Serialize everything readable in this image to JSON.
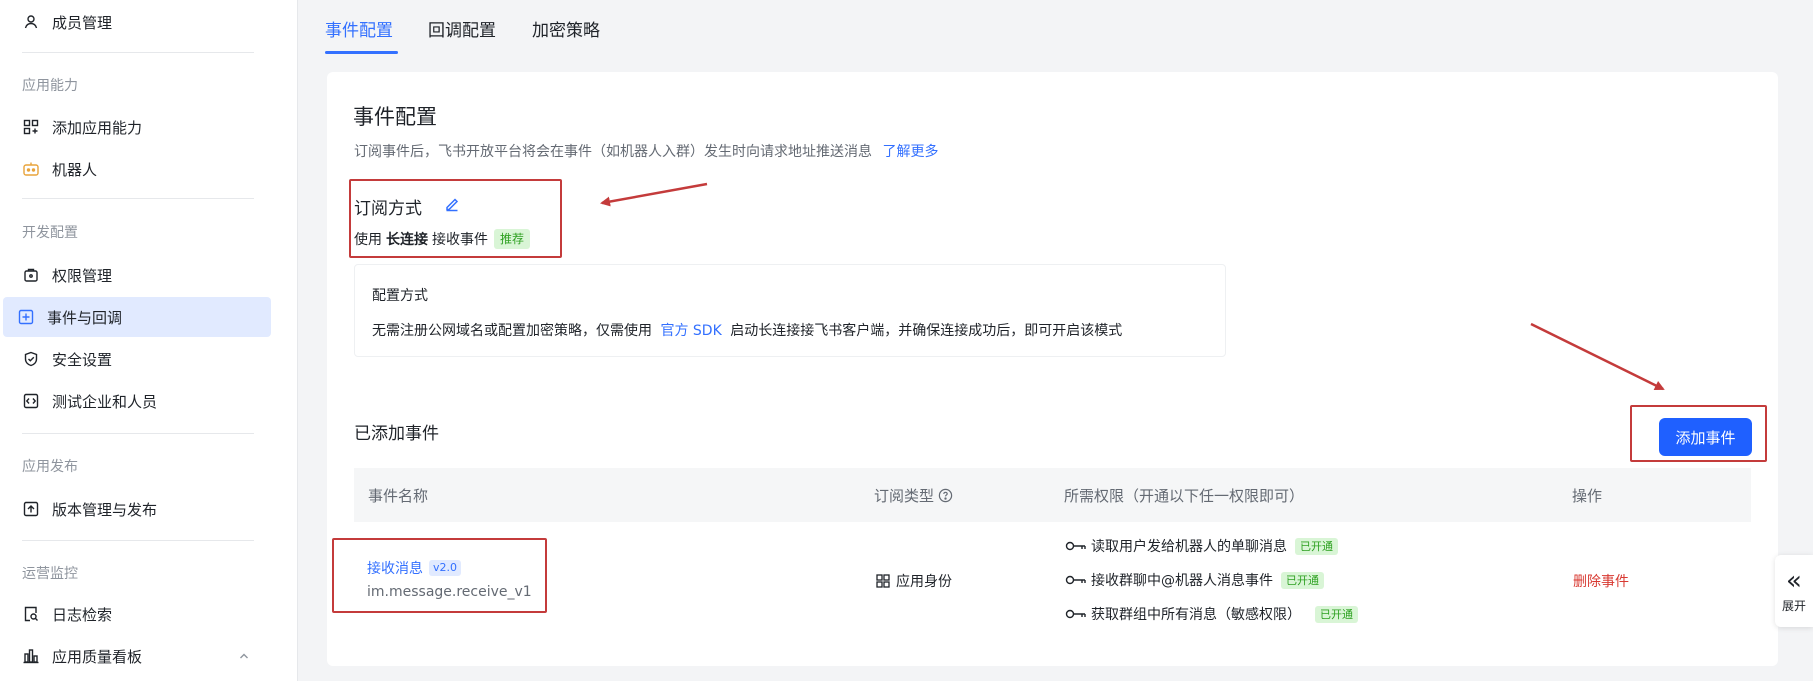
{
  "sidebar": {
    "member_mgmt": "成员管理",
    "section_app_capability": "应用能力",
    "add_capability": "添加应用能力",
    "bot": "机器人",
    "section_dev_config": "开发配置",
    "permission_mgmt": "权限管理",
    "events_callbacks": "事件与回调",
    "security_settings": "安全设置",
    "test_enterprise": "测试企业和人员",
    "section_app_release": "应用发布",
    "version_release": "版本管理与发布",
    "section_ops_monitor": "运营监控",
    "log_search": "日志检索",
    "quality_dashboard": "应用质量看板"
  },
  "tabs": [
    {
      "label": "事件配置"
    },
    {
      "label": "回调配置"
    },
    {
      "label": "加密策略"
    }
  ],
  "main": {
    "title": "事件配置",
    "description": "订阅事件后，飞书开放平台将会在事件（如机器人入群）发生时向请求地址推送消息",
    "learn_more": "了解更多",
    "subscription": {
      "title": "订阅方式",
      "prefix": "使用",
      "method": "长连接",
      "suffix": "接收事件",
      "recommend_tag": "推荐"
    },
    "config": {
      "title": "配置方式",
      "text_before": "无需注册公网域名或配置加密策略，仅需使用",
      "sdk_link": "官方 SDK",
      "text_after": "启动长连接接飞书客户端，并确保连接成功后，即可开启该模式"
    },
    "added_events": {
      "title": "已添加事件",
      "add_button": "添加事件",
      "headers": {
        "name": "事件名称",
        "type": "订阅类型",
        "perms": "所需权限（开通以下任一权限即可）",
        "ops": "操作"
      },
      "rows": [
        {
          "name": "接收消息",
          "version": "v2.0",
          "event_key": "im.message.receive_v1",
          "type": "应用身份",
          "permissions": [
            {
              "label": "读取用户发给机器人的单聊消息",
              "status": "已开通"
            },
            {
              "label": "接收群聊中@机器人消息事件",
              "status": "已开通"
            },
            {
              "label": "获取群组中所有消息（敏感权限）",
              "status": "已开通"
            }
          ],
          "action": "删除事件"
        }
      ]
    }
  },
  "expand_label": "展开",
  "colors": {
    "accent": "#3370ff",
    "primary_button": "#1f60ff",
    "danger": "#d83931",
    "success": "#2ea121",
    "annotation_red": "#c43b3b"
  }
}
